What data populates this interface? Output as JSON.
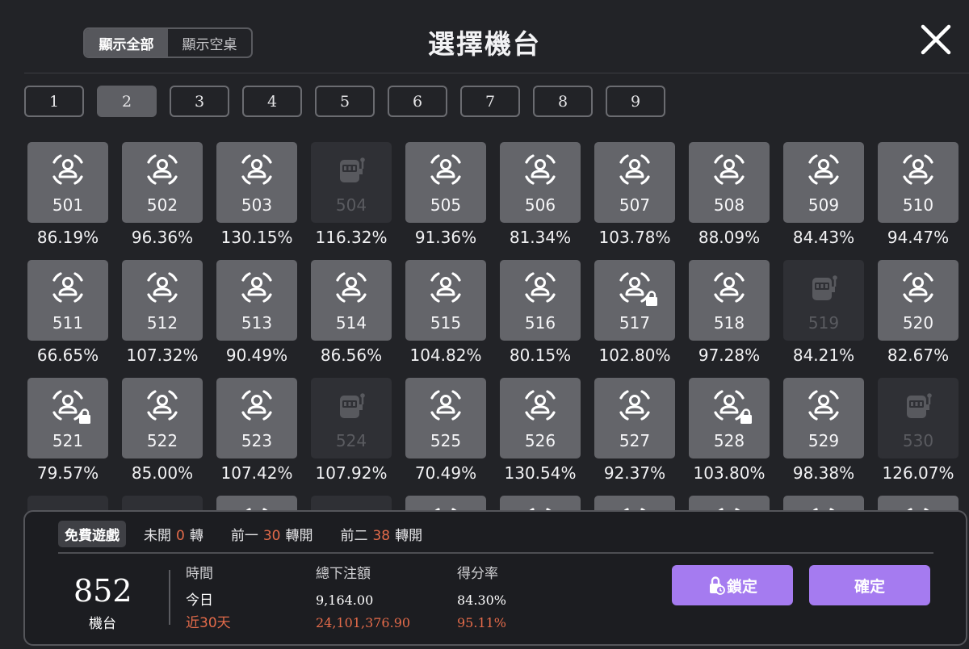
{
  "header": {
    "filter_all": "顯示全部",
    "filter_empty": "顯示空桌",
    "title": "選擇機台"
  },
  "pages": [
    "1",
    "2",
    "3",
    "4",
    "5",
    "6",
    "7",
    "8",
    "9"
  ],
  "active_page": "2",
  "machines": [
    {
      "num": "501",
      "rate": "86.19%",
      "status": "available",
      "locked": false
    },
    {
      "num": "502",
      "rate": "96.36%",
      "status": "available",
      "locked": false
    },
    {
      "num": "503",
      "rate": "130.15%",
      "status": "available",
      "locked": false
    },
    {
      "num": "504",
      "rate": "116.32%",
      "status": "offline",
      "locked": false
    },
    {
      "num": "505",
      "rate": "91.36%",
      "status": "available",
      "locked": false
    },
    {
      "num": "506",
      "rate": "81.34%",
      "status": "available",
      "locked": false
    },
    {
      "num": "507",
      "rate": "103.78%",
      "status": "available",
      "locked": false
    },
    {
      "num": "508",
      "rate": "88.09%",
      "status": "available",
      "locked": false
    },
    {
      "num": "509",
      "rate": "84.43%",
      "status": "available",
      "locked": false
    },
    {
      "num": "510",
      "rate": "94.47%",
      "status": "available",
      "locked": false
    },
    {
      "num": "511",
      "rate": "66.65%",
      "status": "available",
      "locked": false
    },
    {
      "num": "512",
      "rate": "107.32%",
      "status": "available",
      "locked": false
    },
    {
      "num": "513",
      "rate": "90.49%",
      "status": "available",
      "locked": false
    },
    {
      "num": "514",
      "rate": "86.56%",
      "status": "available",
      "locked": false
    },
    {
      "num": "515",
      "rate": "104.82%",
      "status": "available",
      "locked": false
    },
    {
      "num": "516",
      "rate": "80.15%",
      "status": "available",
      "locked": false
    },
    {
      "num": "517",
      "rate": "102.80%",
      "status": "available",
      "locked": true
    },
    {
      "num": "518",
      "rate": "97.28%",
      "status": "available",
      "locked": false
    },
    {
      "num": "519",
      "rate": "84.21%",
      "status": "offline",
      "locked": false
    },
    {
      "num": "520",
      "rate": "82.67%",
      "status": "available",
      "locked": false
    },
    {
      "num": "521",
      "rate": "79.57%",
      "status": "available",
      "locked": true
    },
    {
      "num": "522",
      "rate": "85.00%",
      "status": "available",
      "locked": false
    },
    {
      "num": "523",
      "rate": "107.42%",
      "status": "available",
      "locked": false
    },
    {
      "num": "524",
      "rate": "107.92%",
      "status": "offline",
      "locked": false
    },
    {
      "num": "525",
      "rate": "70.49%",
      "status": "available",
      "locked": false
    },
    {
      "num": "526",
      "rate": "130.54%",
      "status": "available",
      "locked": false
    },
    {
      "num": "527",
      "rate": "92.37%",
      "status": "available",
      "locked": false
    },
    {
      "num": "528",
      "rate": "103.80%",
      "status": "available",
      "locked": true
    },
    {
      "num": "529",
      "rate": "98.38%",
      "status": "available",
      "locked": false
    },
    {
      "num": "530",
      "rate": "126.07%",
      "status": "offline",
      "locked": false
    },
    {
      "num": "",
      "rate": "",
      "status": "offline",
      "locked": false
    },
    {
      "num": "",
      "rate": "",
      "status": "offline",
      "locked": false
    },
    {
      "num": "",
      "rate": "",
      "status": "available",
      "locked": false
    },
    {
      "num": "",
      "rate": "",
      "status": "offline",
      "locked": false
    },
    {
      "num": "",
      "rate": "",
      "status": "available",
      "locked": false
    },
    {
      "num": "",
      "rate": "",
      "status": "available",
      "locked": false
    },
    {
      "num": "",
      "rate": "",
      "status": "available",
      "locked": false
    },
    {
      "num": "",
      "rate": "",
      "status": "available",
      "locked": false
    },
    {
      "num": "",
      "rate": "",
      "status": "available",
      "locked": false
    },
    {
      "num": "",
      "rate": "",
      "status": "available",
      "locked": false
    }
  ],
  "panel": {
    "free_game": "免費遊戲",
    "unopened_label": "未開",
    "unopened_count": "0",
    "spin_unit": "轉",
    "prev1_label": "前一",
    "prev1_count": "30",
    "prev1_unit": "轉開",
    "prev2_label": "前二",
    "prev2_count": "38",
    "prev2_unit": "轉開",
    "machine_number": "852",
    "machine_label": "機台",
    "col_time": "時間",
    "col_bet": "總下注額",
    "col_rate": "得分率",
    "today_label": "今日",
    "today_bet": "9,164.00",
    "today_rate": "84.30%",
    "month_label": "近30天",
    "month_bet": "24,101,376.90",
    "month_rate": "95.11%",
    "lock_button": "鎖定",
    "confirm_button": "確定"
  },
  "colors": {
    "accent": "#a57bf0",
    "highlight": "#e46b4a",
    "tile": "#64656a",
    "tile_offline": "#2f3035"
  },
  "icons": {
    "available": "face-scan-icon",
    "offline": "slot-machine-icon",
    "locked": "lock-icon",
    "close": "close-icon"
  }
}
